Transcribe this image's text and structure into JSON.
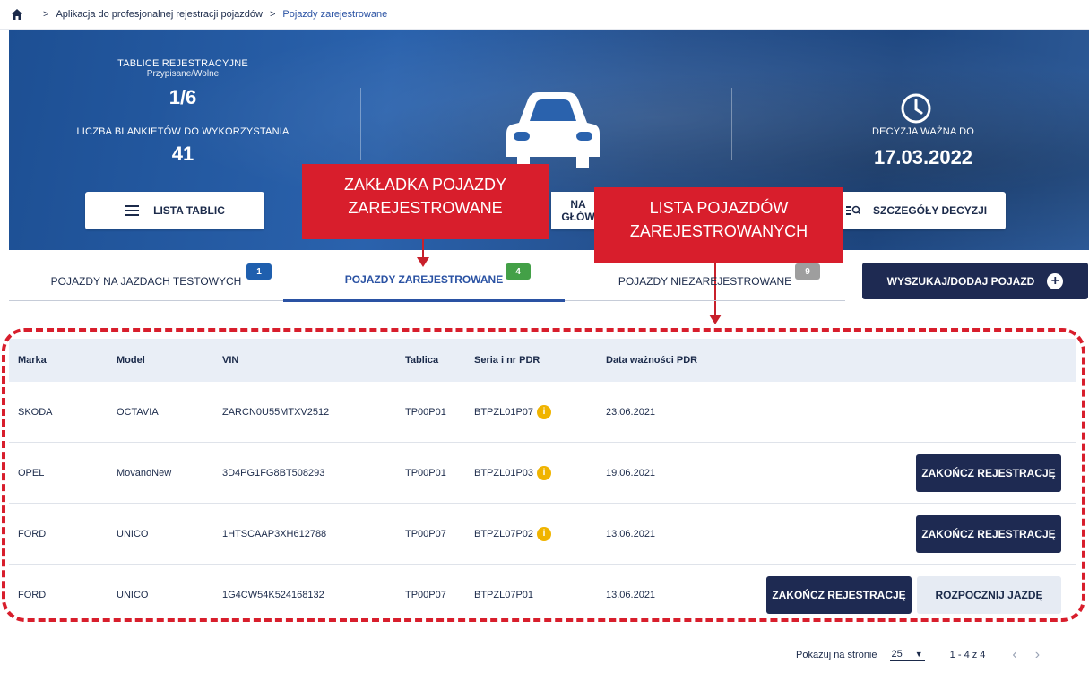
{
  "breadcrumb": {
    "items": [
      "Aplikacja do profesjonalnej rejestracji pojazdów",
      "Pojazdy zarejestrowane"
    ],
    "separator": ">"
  },
  "hero": {
    "plates_title": "TABLICE REJESTRACYJNE",
    "plates_sub": "Przypisane/Wolne",
    "plates_value": "1/6",
    "blanks_title": "LICZBA BLANKIETÓW DO WYKORZYSTANIA",
    "blanks_value": "41",
    "decision_title": "DECYZJA WAŻNA DO",
    "decision_value": "17.03.2022",
    "btn_list": "LISTA TABLIC",
    "btn_main_partial": "NA GŁÓW",
    "btn_details": "SZCZEGÓŁY DECYZJI"
  },
  "callouts": {
    "tab_label_line1": "ZAKŁADKA POJAZDY",
    "tab_label_line2": "ZAREJESTROWANE",
    "list_label_line1": "LISTA POJAZDÓW",
    "list_label_line2": "ZAREJESTROWANYCH"
  },
  "tabs": [
    {
      "label": "POJAZDY NA JAZDACH TESTOWYCH",
      "count": "1",
      "color": "#1f5fae"
    },
    {
      "label": "POJAZDY ZAREJESTROWANE",
      "count": "4",
      "color": "#43a047"
    },
    {
      "label": "POJAZDY NIEZAREJESTROWANE",
      "count": "9",
      "color": "#9e9e9e"
    }
  ],
  "search_button": "WYSZUKAJ/DODAJ POJAZD",
  "table": {
    "headers": [
      "Marka",
      "Model",
      "VIN",
      "Tablica",
      "Seria i nr PDR",
      "Data ważności PDR"
    ],
    "rows": [
      {
        "marka": "SKODA",
        "model": "OCTAVIA",
        "vin": "ZARCN0U55MTXV2512",
        "tablica": "TP00P01",
        "seria": "BTPZL01P07",
        "data": "23.06.2021"
      },
      {
        "marka": "OPEL",
        "model": "MovanoNew",
        "vin": "3D4PG1FG8BT508293",
        "tablica": "TP00P01",
        "seria": "BTPZL01P03",
        "data": "19.06.2021"
      },
      {
        "marka": "FORD",
        "model": "UNICO",
        "vin": "1HTSCAAP3XH612788",
        "tablica": "TP00P07",
        "seria": "BTPZL07P02",
        "data": "13.06.2021"
      },
      {
        "marka": "FORD",
        "model": "UNICO",
        "vin": "1G4CW54K524168132",
        "tablica": "TP00P07",
        "seria": "BTPZL07P01",
        "data": "13.06.2021"
      }
    ],
    "btn_finish": "ZAKOŃCZ REJESTRACJĘ",
    "btn_start": "ROZPOCZNIJ JAZDĘ"
  },
  "pagination": {
    "per_page_label": "Pokazuj na stronie",
    "per_page_value": "25",
    "range": "1 - 4 z 4"
  },
  "colors": {
    "accent_dark": "#1e2a52",
    "callout_red": "#d81e2c",
    "info_yellow": "#f0b400"
  }
}
